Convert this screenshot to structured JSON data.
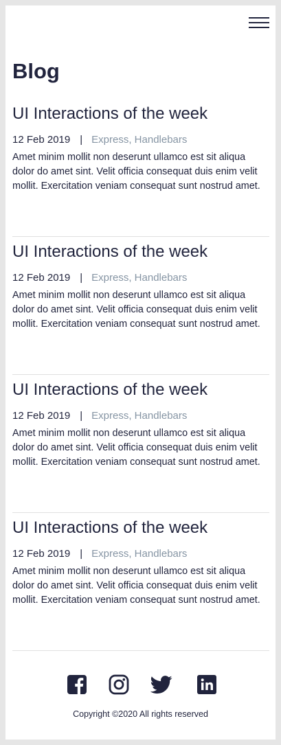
{
  "header": {
    "menu_icon": "hamburger-icon"
  },
  "page": {
    "title": "Blog"
  },
  "posts": [
    {
      "title": "UI Interactions of the week",
      "date": "12 Feb 2019",
      "separator": "|",
      "tags": "Express, Handlebars",
      "excerpt": "Amet minim mollit non deserunt ullamco est sit aliqua dolor do amet sint. Velit officia consequat duis enim velit mollit. Exercitation veniam consequat sunt nostrud amet."
    },
    {
      "title": "UI Interactions of the week",
      "date": "12 Feb 2019",
      "separator": "|",
      "tags": "Express, Handlebars",
      "excerpt": "Amet minim mollit non deserunt ullamco est sit aliqua dolor do amet sint. Velit officia consequat duis enim velit mollit. Exercitation veniam consequat sunt nostrud amet."
    },
    {
      "title": "UI Interactions of the week",
      "date": "12 Feb 2019",
      "separator": "|",
      "tags": "Express, Handlebars",
      "excerpt": "Amet minim mollit non deserunt ullamco est sit aliqua dolor do amet sint. Velit officia consequat duis enim velit mollit. Exercitation veniam consequat sunt nostrud amet."
    },
    {
      "title": "UI Interactions of the week",
      "date": "12 Feb 2019",
      "separator": "|",
      "tags": "Express, Handlebars",
      "excerpt": "Amet minim mollit non deserunt ullamco est sit aliqua dolor do amet sint. Velit officia consequat duis enim velit mollit. Exercitation veniam consequat sunt nostrud amet."
    }
  ],
  "footer": {
    "social": [
      {
        "icon": "facebook-icon"
      },
      {
        "icon": "instagram-icon"
      },
      {
        "icon": "twitter-icon"
      },
      {
        "icon": "linkedin-icon"
      }
    ],
    "copyright": "Copyright ©2020 All rights reserved"
  },
  "colors": {
    "text": "#21243d",
    "muted": "#8695a4",
    "divider": "#e0e0e0",
    "background": "#e6e6e6",
    "surface": "#ffffff"
  }
}
